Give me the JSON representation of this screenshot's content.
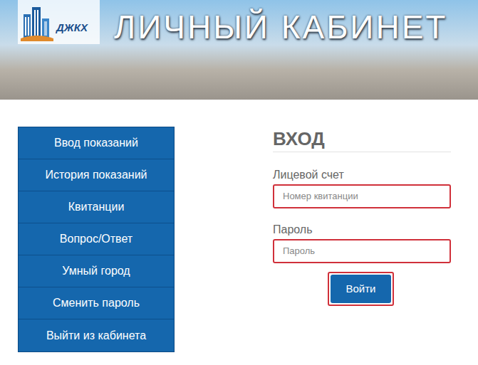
{
  "header": {
    "logo_text": "ДЖКХ",
    "title": "ЛИЧНЫЙ КАБИНЕТ"
  },
  "sidebar": {
    "items": [
      {
        "label": "Ввод показаний"
      },
      {
        "label": "История показаний"
      },
      {
        "label": "Квитанции"
      },
      {
        "label": "Вопрос/Ответ"
      },
      {
        "label": "Умный город"
      },
      {
        "label": "Сменить пароль"
      },
      {
        "label": "Выйти из кабинета"
      }
    ]
  },
  "login": {
    "title": "ВХОД",
    "fields": [
      {
        "label": "Лицевой счет",
        "placeholder": "Номер квитанции",
        "highlighted": true
      },
      {
        "label": "Пароль",
        "placeholder": "Пароль",
        "highlighted": true
      }
    ],
    "button": {
      "label": "Войти",
      "highlighted": true
    }
  }
}
